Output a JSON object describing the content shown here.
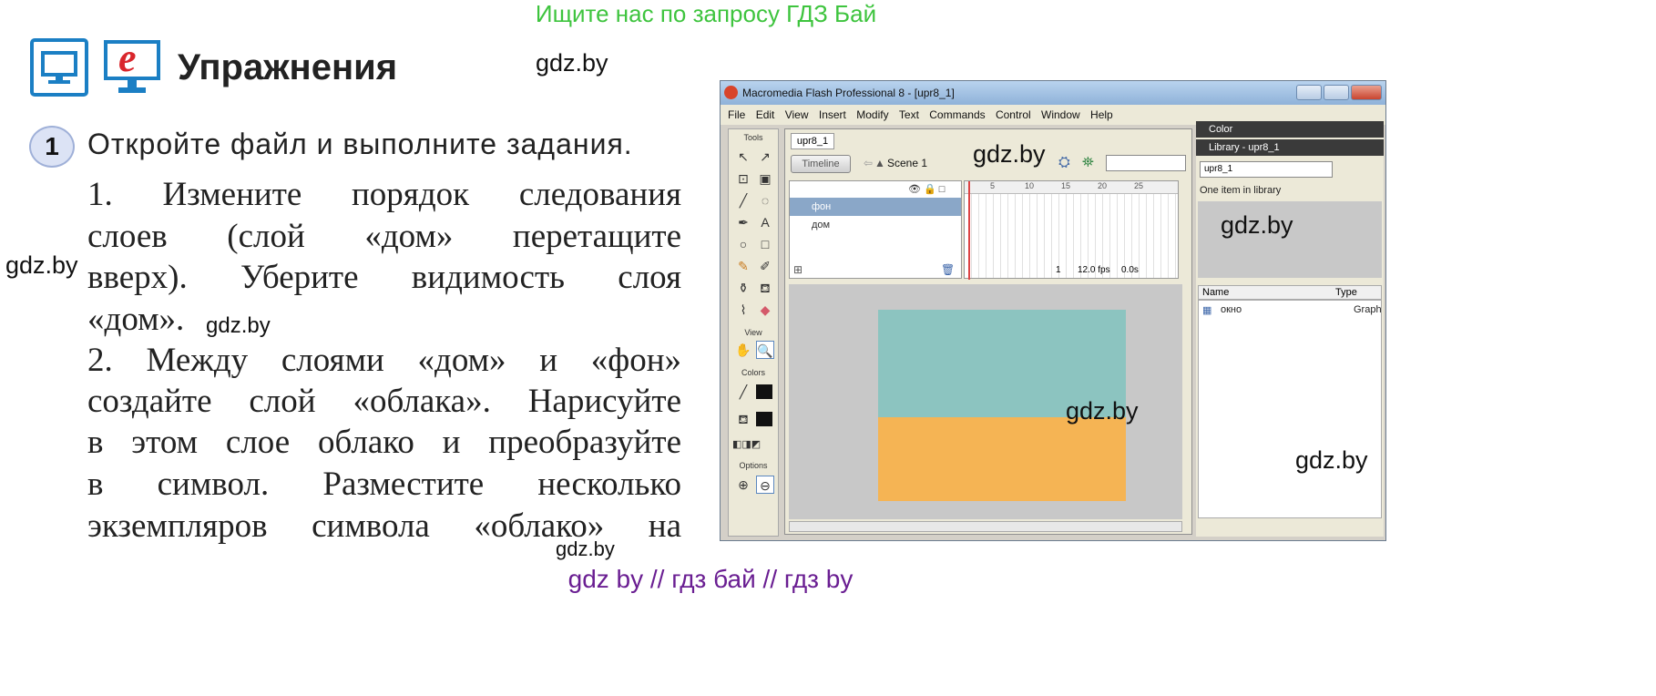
{
  "banner": "Ищите нас по запросу ГДЗ Бай",
  "section": {
    "title": "Упражнения",
    "e_icon_letter": "e"
  },
  "watermarks": {
    "w1": "gdz.by",
    "w2": "gdz.by",
    "w3": "gdz.by",
    "w4": "gdz.by",
    "w5": "gdz.by",
    "w6": "gdz.by",
    "w7": "gdz.by",
    "w8": "gdz.by"
  },
  "task": {
    "number": "1",
    "lead": "Откройте файл и выполните задания.",
    "lines": [
      "1. Измените порядок следования",
      "слоев (слой «дом» перетащите",
      "вверх). Уберите видимость слоя",
      "«дом».",
      "2. Между слоями «дом» и «фон»",
      "создайте слой «облака». Нарисуйте",
      "в этом слое облако и преобразуйте",
      "в символ. Разместите несколько",
      "экземпляров символа «облако» на"
    ]
  },
  "flash": {
    "title": "Macromedia Flash Professional 8 - [upr8_1]",
    "menu": [
      "File",
      "Edit",
      "View",
      "Insert",
      "Modify",
      "Text",
      "Commands",
      "Control",
      "Window",
      "Help"
    ],
    "tools_label": "Tools",
    "view_label": "View",
    "colors_label": "Colors",
    "options_label": "Options",
    "doc_tab": "upr8_1",
    "timeline_button": "Timeline",
    "scene": "Scene 1",
    "layers": [
      "фон",
      "дом"
    ],
    "ruler": [
      "5",
      "10",
      "15",
      "20",
      "25"
    ],
    "frame_number": "1",
    "fps": "12.0 fps",
    "time": "0.0s",
    "color_panel": "Color",
    "library_panel": "Library - upr8_1",
    "library_select": "upr8_1",
    "library_count": "One item in library",
    "library_columns": {
      "name": "Name",
      "type": "Type"
    },
    "library_item": {
      "name": "окно",
      "type": "Graph"
    },
    "stage_colors": {
      "top": "#8cc4c0",
      "bottom": "#f5b454"
    }
  },
  "footer": "gdz by  //  гдз бай  //  гдз by"
}
